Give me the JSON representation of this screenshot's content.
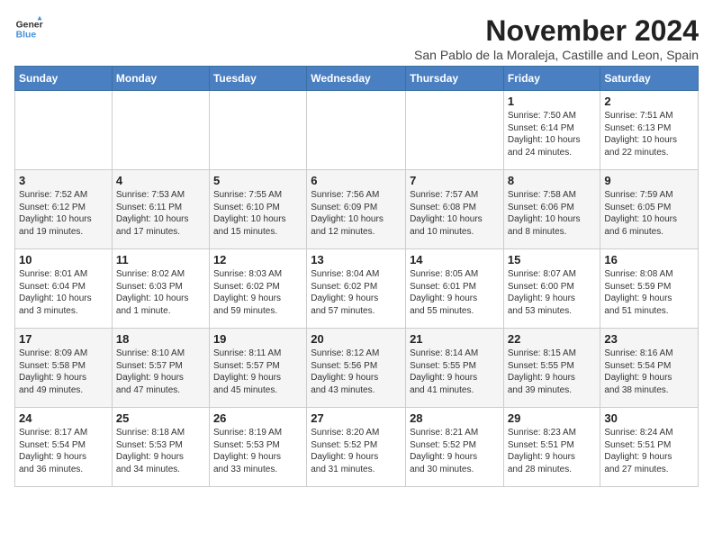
{
  "logo": {
    "general": "General",
    "blue": "Blue"
  },
  "title": "November 2024",
  "subtitle": "San Pablo de la Moraleja, Castille and Leon, Spain",
  "weekdays": [
    "Sunday",
    "Monday",
    "Tuesday",
    "Wednesday",
    "Thursday",
    "Friday",
    "Saturday"
  ],
  "weeks": [
    [
      {
        "day": "",
        "info": ""
      },
      {
        "day": "",
        "info": ""
      },
      {
        "day": "",
        "info": ""
      },
      {
        "day": "",
        "info": ""
      },
      {
        "day": "",
        "info": ""
      },
      {
        "day": "1",
        "info": "Sunrise: 7:50 AM\nSunset: 6:14 PM\nDaylight: 10 hours\nand 24 minutes."
      },
      {
        "day": "2",
        "info": "Sunrise: 7:51 AM\nSunset: 6:13 PM\nDaylight: 10 hours\nand 22 minutes."
      }
    ],
    [
      {
        "day": "3",
        "info": "Sunrise: 7:52 AM\nSunset: 6:12 PM\nDaylight: 10 hours\nand 19 minutes."
      },
      {
        "day": "4",
        "info": "Sunrise: 7:53 AM\nSunset: 6:11 PM\nDaylight: 10 hours\nand 17 minutes."
      },
      {
        "day": "5",
        "info": "Sunrise: 7:55 AM\nSunset: 6:10 PM\nDaylight: 10 hours\nand 15 minutes."
      },
      {
        "day": "6",
        "info": "Sunrise: 7:56 AM\nSunset: 6:09 PM\nDaylight: 10 hours\nand 12 minutes."
      },
      {
        "day": "7",
        "info": "Sunrise: 7:57 AM\nSunset: 6:08 PM\nDaylight: 10 hours\nand 10 minutes."
      },
      {
        "day": "8",
        "info": "Sunrise: 7:58 AM\nSunset: 6:06 PM\nDaylight: 10 hours\nand 8 minutes."
      },
      {
        "day": "9",
        "info": "Sunrise: 7:59 AM\nSunset: 6:05 PM\nDaylight: 10 hours\nand 6 minutes."
      }
    ],
    [
      {
        "day": "10",
        "info": "Sunrise: 8:01 AM\nSunset: 6:04 PM\nDaylight: 10 hours\nand 3 minutes."
      },
      {
        "day": "11",
        "info": "Sunrise: 8:02 AM\nSunset: 6:03 PM\nDaylight: 10 hours\nand 1 minute."
      },
      {
        "day": "12",
        "info": "Sunrise: 8:03 AM\nSunset: 6:02 PM\nDaylight: 9 hours\nand 59 minutes."
      },
      {
        "day": "13",
        "info": "Sunrise: 8:04 AM\nSunset: 6:02 PM\nDaylight: 9 hours\nand 57 minutes."
      },
      {
        "day": "14",
        "info": "Sunrise: 8:05 AM\nSunset: 6:01 PM\nDaylight: 9 hours\nand 55 minutes."
      },
      {
        "day": "15",
        "info": "Sunrise: 8:07 AM\nSunset: 6:00 PM\nDaylight: 9 hours\nand 53 minutes."
      },
      {
        "day": "16",
        "info": "Sunrise: 8:08 AM\nSunset: 5:59 PM\nDaylight: 9 hours\nand 51 minutes."
      }
    ],
    [
      {
        "day": "17",
        "info": "Sunrise: 8:09 AM\nSunset: 5:58 PM\nDaylight: 9 hours\nand 49 minutes."
      },
      {
        "day": "18",
        "info": "Sunrise: 8:10 AM\nSunset: 5:57 PM\nDaylight: 9 hours\nand 47 minutes."
      },
      {
        "day": "19",
        "info": "Sunrise: 8:11 AM\nSunset: 5:57 PM\nDaylight: 9 hours\nand 45 minutes."
      },
      {
        "day": "20",
        "info": "Sunrise: 8:12 AM\nSunset: 5:56 PM\nDaylight: 9 hours\nand 43 minutes."
      },
      {
        "day": "21",
        "info": "Sunrise: 8:14 AM\nSunset: 5:55 PM\nDaylight: 9 hours\nand 41 minutes."
      },
      {
        "day": "22",
        "info": "Sunrise: 8:15 AM\nSunset: 5:55 PM\nDaylight: 9 hours\nand 39 minutes."
      },
      {
        "day": "23",
        "info": "Sunrise: 8:16 AM\nSunset: 5:54 PM\nDaylight: 9 hours\nand 38 minutes."
      }
    ],
    [
      {
        "day": "24",
        "info": "Sunrise: 8:17 AM\nSunset: 5:54 PM\nDaylight: 9 hours\nand 36 minutes."
      },
      {
        "day": "25",
        "info": "Sunrise: 8:18 AM\nSunset: 5:53 PM\nDaylight: 9 hours\nand 34 minutes."
      },
      {
        "day": "26",
        "info": "Sunrise: 8:19 AM\nSunset: 5:53 PM\nDaylight: 9 hours\nand 33 minutes."
      },
      {
        "day": "27",
        "info": "Sunrise: 8:20 AM\nSunset: 5:52 PM\nDaylight: 9 hours\nand 31 minutes."
      },
      {
        "day": "28",
        "info": "Sunrise: 8:21 AM\nSunset: 5:52 PM\nDaylight: 9 hours\nand 30 minutes."
      },
      {
        "day": "29",
        "info": "Sunrise: 8:23 AM\nSunset: 5:51 PM\nDaylight: 9 hours\nand 28 minutes."
      },
      {
        "day": "30",
        "info": "Sunrise: 8:24 AM\nSunset: 5:51 PM\nDaylight: 9 hours\nand 27 minutes."
      }
    ]
  ]
}
